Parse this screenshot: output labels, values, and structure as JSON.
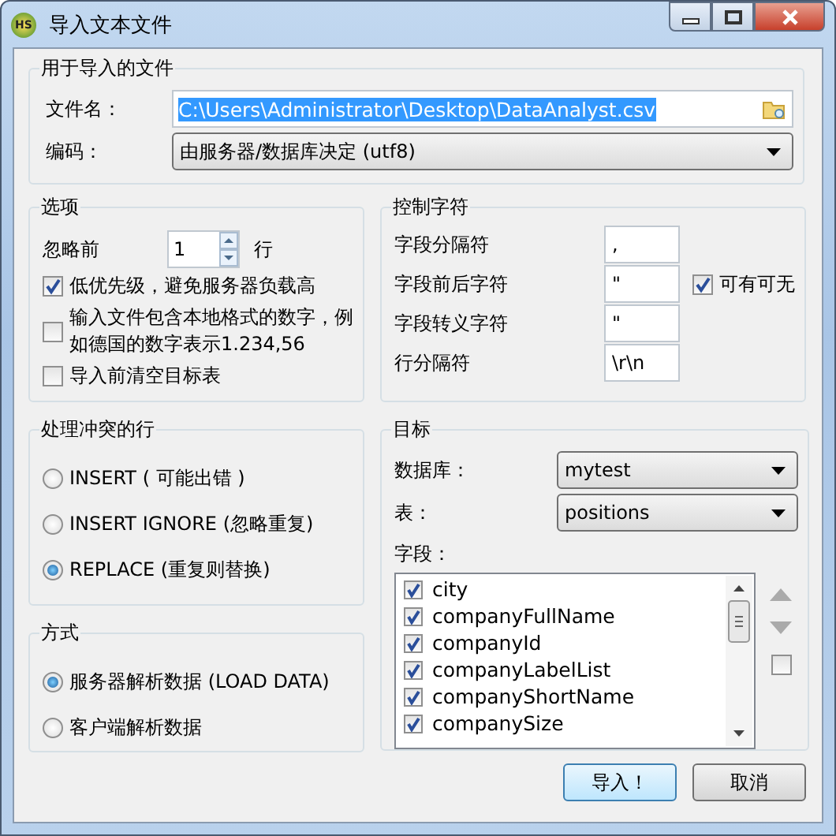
{
  "window": {
    "title": "导入文本文件",
    "app_icon_text": "HS"
  },
  "file_group": {
    "title": "用于导入的文件",
    "filename_label": "文件名：",
    "filename": "C:\\Users\\Administrator\\Desktop\\DataAnalyst.csv",
    "filename_selected": true,
    "encoding_label": "编码：",
    "encoding": "由服务器/数据库决定 (utf8)"
  },
  "options": {
    "title": "选项",
    "skip_label": "忽略前",
    "skip_value": "1",
    "skip_unit": "行",
    "checkboxes": [
      {
        "label": "低优先级，避免服务器负载高",
        "checked": true
      },
      {
        "label": "输入文件包含本地格式的数字，例如德国的数字表示1.234,56",
        "checked": false
      },
      {
        "label": "导入前清空目标表",
        "checked": false
      }
    ]
  },
  "control_chars": {
    "title": "控制字符",
    "rows": [
      {
        "label": "字段分隔符",
        "value": ","
      },
      {
        "label": "字段前后字符",
        "value": "\"",
        "option": {
          "label": "可有可无",
          "checked": true
        }
      },
      {
        "label": "字段转义字符",
        "value": "\""
      },
      {
        "label": "行分隔符",
        "value": "\\r\\n"
      }
    ]
  },
  "conflict": {
    "title": "处理冲突的行",
    "options": [
      {
        "label": "INSERT ( 可能出错 )",
        "selected": false
      },
      {
        "label": "INSERT IGNORE (忽略重复)",
        "selected": false
      },
      {
        "label": "REPLACE (重复则替换)",
        "selected": true
      }
    ]
  },
  "method": {
    "title": "方式",
    "options": [
      {
        "label": "服务器解析数据 (LOAD DATA)",
        "selected": true
      },
      {
        "label": "客户端解析数据",
        "selected": false
      }
    ]
  },
  "target": {
    "title": "目标",
    "database_label": "数据库：",
    "database": "mytest",
    "table_label": "表：",
    "table": "positions",
    "fields_label": "字段：",
    "select_all_checked": false,
    "fields": [
      {
        "name": "city",
        "checked": true
      },
      {
        "name": "companyFullName",
        "checked": true
      },
      {
        "name": "companyId",
        "checked": true
      },
      {
        "name": "companyLabelList",
        "checked": true
      },
      {
        "name": "companyShortName",
        "checked": true
      },
      {
        "name": "companySize",
        "checked": true
      }
    ]
  },
  "buttons": [
    {
      "label": "导入！",
      "default": true
    },
    {
      "label": "取消",
      "default": false
    }
  ]
}
